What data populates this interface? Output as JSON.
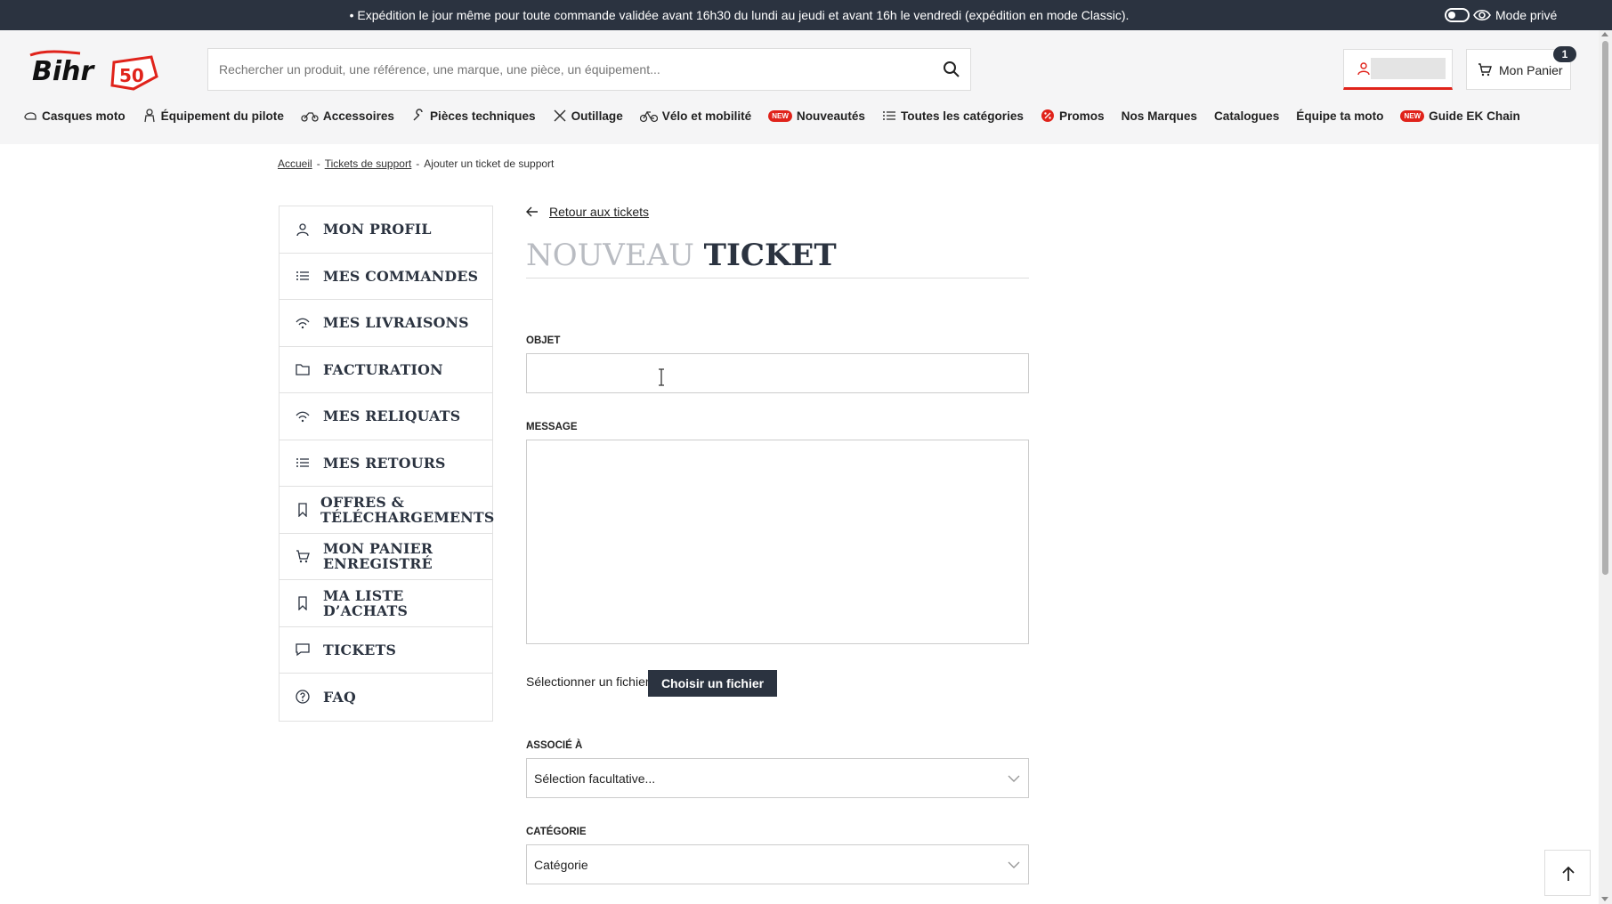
{
  "topbar": {
    "message": "• Expédition le jour même pour toute commande validée avant 16h30 du lundi au jeudi et avant 16h le vendredi (expédition en mode Classic).",
    "private_mode_label": "Mode privé"
  },
  "header": {
    "search_placeholder": "Rechercher un produit, une référence, une marque, une pièce, un équipement...",
    "cart_label": "Mon Panier",
    "cart_count": "1"
  },
  "nav": {
    "new_pill": "NEW",
    "items": [
      {
        "label": "Casques moto",
        "icon": "helmet-icon"
      },
      {
        "label": "Équipement du pilote",
        "icon": "rider-icon"
      },
      {
        "label": "Accessoires",
        "icon": "motorbike-icon"
      },
      {
        "label": "Pièces techniques",
        "icon": "wrench-icon"
      },
      {
        "label": "Outillage",
        "icon": "tools-icon"
      },
      {
        "label": "Vélo et mobilité",
        "icon": "bicycle-icon"
      },
      {
        "label": "Nouveautés",
        "icon": "new-badge"
      },
      {
        "label": "Toutes les catégories",
        "icon": "list-icon"
      },
      {
        "label": "Promos",
        "icon": "percent-icon"
      },
      {
        "label": "Nos Marques",
        "icon": ""
      },
      {
        "label": "Catalogues",
        "icon": ""
      },
      {
        "label": "Équipe ta moto",
        "icon": ""
      },
      {
        "label": "Guide EK Chain",
        "icon": "new-badge"
      }
    ]
  },
  "breadcrumb": {
    "home": "Accueil",
    "tickets": "Tickets de support",
    "current": "Ajouter un ticket de support"
  },
  "sidebar": {
    "items": [
      {
        "label": "MON PROFIL",
        "icon": "user-icon"
      },
      {
        "label": "MES COMMANDES",
        "icon": "list-icon"
      },
      {
        "label": "MES LIVRAISONS",
        "icon": "signal-icon"
      },
      {
        "label": "FACTURATION",
        "icon": "folder-icon"
      },
      {
        "label": "MES RELIQUATS",
        "icon": "signal-icon"
      },
      {
        "label": "MES RETOURS",
        "icon": "list-icon"
      },
      {
        "label": "OFFRES &\nTÉLÉCHARGEMENTS",
        "icon": "bookmark-icon"
      },
      {
        "label": "MON PANIER\nENREGISTRÉ",
        "icon": "cart-icon"
      },
      {
        "label": "MA LISTE\nD’ACHATS",
        "icon": "bookmark-icon"
      },
      {
        "label": "TICKETS",
        "icon": "chat-icon"
      },
      {
        "label": "FAQ",
        "icon": "help-icon"
      }
    ]
  },
  "main": {
    "back_label": "Retour aux tickets",
    "title_light": "NOUVEAU",
    "title_bold": "TICKET",
    "objet_label": "OBJET",
    "objet_value": "",
    "message_label": "MESSAGE",
    "message_value": "",
    "file_label": "Sélectionner un fichier",
    "file_button": "Choisir un fichier",
    "associe_label": "ASSOCIÉ À",
    "associe_value": "Sélection facultative...",
    "categorie_label": "CATÉGORIE",
    "categorie_value": "Catégorie"
  },
  "colors": {
    "dark": "#2b3340",
    "accent_red": "#e0231b"
  }
}
